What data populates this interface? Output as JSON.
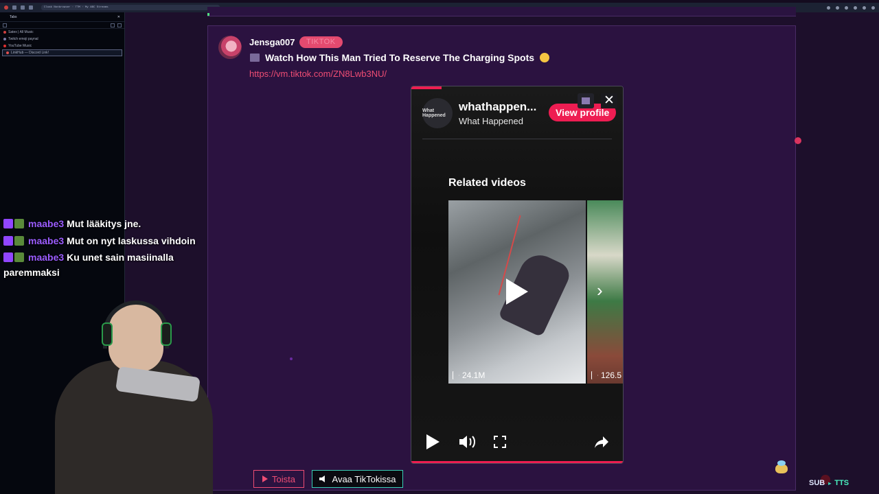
{
  "browser": {
    "url": "Cloak Nonbrowser · TTM · My ABC Streams"
  },
  "tabs_sidebar": {
    "header": "Tabs",
    "items": [
      {
        "label": "Satex | All Music",
        "color": "#d04040"
      },
      {
        "label": "Twitch emoji paynal",
        "color": "#7a7aa8"
      },
      {
        "label": "YouTube Music",
        "color": "#e03030"
      },
      {
        "label": "LinkHub — Discord Link!",
        "color": "#e05050"
      }
    ]
  },
  "post": {
    "username": "Jensga007",
    "tag": "TIKTOK",
    "title": "Watch How This Man Tried To Reserve The Charging Spots",
    "link": "https://vm.tiktok.com/ZN8Lwb3NU/"
  },
  "tiktok_embed": {
    "logo_text": "What Happened",
    "account_handle": "whathappen...",
    "account_name": "What Happened",
    "view_profile_label": "View profile",
    "close_label": "✕",
    "related_title": "Related videos",
    "videos": [
      {
        "views": "24.1M"
      },
      {
        "views": "126.5"
      }
    ]
  },
  "chat": {
    "messages": [
      {
        "user": "maabe3",
        "text": "Mut lääkitys jne."
      },
      {
        "user": "maabe3",
        "text": "Mut on nyt laskussa vihdoin"
      },
      {
        "user": "maabe3",
        "text": "Ku unet sain masiinalla paremmaksi"
      }
    ]
  },
  "buttons": {
    "play_label": "Toista",
    "open_label": "Avaa TikTokissa"
  },
  "overlay": {
    "sub_label": "SUB",
    "arrow": "▸",
    "tts_label": "TTS"
  }
}
